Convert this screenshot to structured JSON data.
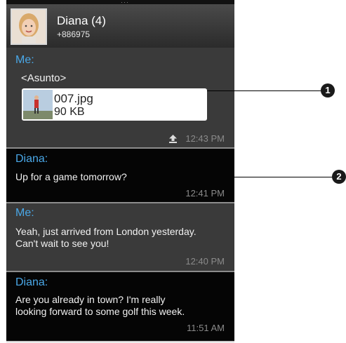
{
  "header": {
    "contact_name": "Diana (4)",
    "contact_number": "+886975"
  },
  "messages": [
    {
      "sender": "Me:",
      "subject": "<Asunto>",
      "attachment": {
        "file_name": "007.jpg",
        "file_size": "90 KB"
      },
      "time": "12:43 PM",
      "status_icon": "upload-icon"
    },
    {
      "sender": "Diana:",
      "lines": [
        "Up for a game tomorrow?"
      ],
      "time": "12:41 PM"
    },
    {
      "sender": "Me:",
      "lines": [
        "Yeah, just arrived from London yesterday.",
        "Can't wait to see you!"
      ],
      "time": "12:40 PM"
    },
    {
      "sender": "Diana:",
      "lines": [
        "Are you already in town? I'm really",
        "looking forward to some golf this week."
      ],
      "time": "11:51 AM"
    }
  ],
  "callouts": [
    "1",
    "2"
  ],
  "colors": {
    "sender_blue": "#4aa8e8",
    "sent_background": "#3a3a3a",
    "received_background": "#050505"
  }
}
